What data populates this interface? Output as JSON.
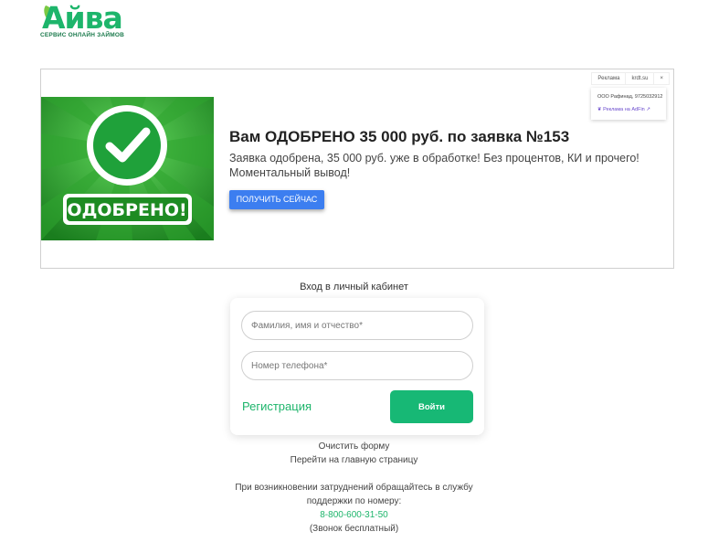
{
  "brand": {
    "name": "Айва",
    "tagline": "СЕРВИС ОНЛАЙН ЗАЙМОВ"
  },
  "ad": {
    "badge_text": "ОДОБРЕНО!",
    "title": "Вам ОДОБРЕНО 35 000 руб. по заявка №153",
    "description": "Заявка одобрена, 35 000 руб. уже в обработке! Без процентов, КИ и прочего! Моментальный вывод!",
    "cta": "ПОЛУЧИТЬ СЕЙЧАС",
    "top_bar": {
      "label": "Реклама",
      "domain": "krdt.su",
      "close": "×"
    },
    "info": {
      "org": "ООО Рафинад, 9725032912",
      "network": "Реклама на AdFin",
      "arrow": "↗"
    }
  },
  "login": {
    "title": "Вход в личный кабинет",
    "name_placeholder": "Фамилия, имя и отчество*",
    "phone_placeholder": "Номер телефона*",
    "register_label": "Регистрация",
    "login_button": "Войти"
  },
  "links": {
    "clear_form": "Очистить форму",
    "home": "Перейти на главную страницу"
  },
  "support": {
    "line1": "При возникновении затруднений обращайтесь в службу",
    "line2": "поддержки по номеру:",
    "phone": "8-800-600-31-50",
    "note": "(Звонок бесплатный)"
  },
  "colors": {
    "brand_green": "#1db56b",
    "cta_blue": "#3c7ef0",
    "login_green": "#17b875"
  }
}
